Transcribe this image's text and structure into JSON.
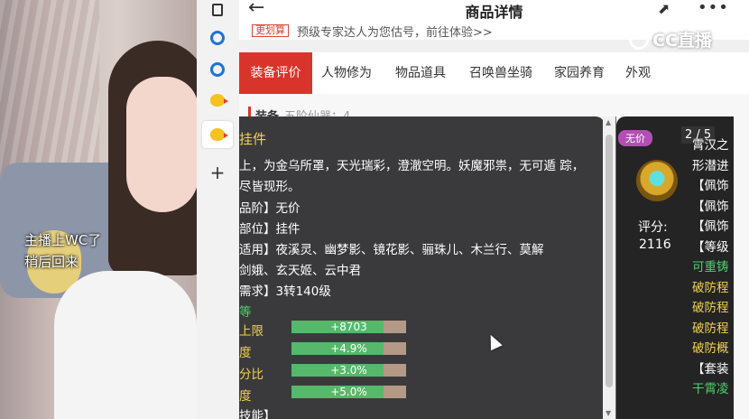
{
  "cam": {
    "note_line1": "主播上WC了",
    "note_line2": "稍后回来"
  },
  "tabstrip": {
    "items": [
      {
        "icon": "tabs-icon"
      },
      {
        "icon": "ie-icon"
      },
      {
        "icon": "ie-icon"
      },
      {
        "icon": "chick-icon"
      },
      {
        "icon": "chick-icon",
        "active": true
      },
      {
        "icon": "plus-icon"
      }
    ]
  },
  "header": {
    "title": "商品详情",
    "back": "←",
    "share": "⬈",
    "more": "•••"
  },
  "notice": {
    "badge": "更划算",
    "text": "预级专家达人为您估号，前往体验>>"
  },
  "tabs": [
    "装备评价",
    "人物修为",
    "物品道具",
    "召唤兽坐骑",
    "家园养育",
    "外观"
  ],
  "section": {
    "title": "装备",
    "subtitle": "五阶仙器：4"
  },
  "tooltip": {
    "name": "挂件",
    "desc": "上，为金乌所罩，天光瑞彩，澄澈空明。妖魔邪祟，无可遁 踪，尽皆现形。",
    "lines": [
      "品阶】无价",
      "部位】挂件",
      "适用】夜溪灵、幽梦影、镜花影、骊珠儿、木兰行、莫解",
      "剑娥、玄天姬、云中君",
      "需求】3转140级"
    ],
    "green": "等",
    "attrs": [
      {
        "label": "上限",
        "value": "+8703",
        "pct": 0.8
      },
      {
        "label": "度",
        "value": "+4.9%",
        "pct": 0.8
      },
      {
        "label": "分比",
        "value": "+3.0%",
        "pct": 0.8
      },
      {
        "label": "度",
        "value": "+5.0%",
        "pct": 0.8
      }
    ],
    "last": "技能】"
  },
  "card": {
    "badge": "无价",
    "pager": "2 / 5",
    "score_label": "评分:",
    "score": "2116",
    "lines": [
      {
        "text": "霄汉之",
        "color": "#ffffff"
      },
      {
        "text": "形潜进",
        "color": "#ffffff"
      },
      {
        "text": "【佩饰",
        "color": "#ffffff"
      },
      {
        "text": "【佩饰",
        "color": "#ffffff"
      },
      {
        "text": "【佩饰",
        "color": "#ffffff"
      },
      {
        "text": "【等级",
        "color": "#ffffff"
      },
      {
        "text": "可重铸",
        "color": "#4cd26b"
      },
      {
        "text": "破防程",
        "color": "#f2d24d"
      },
      {
        "text": "破防程",
        "color": "#f2d24d"
      },
      {
        "text": "破防程",
        "color": "#f2d24d"
      },
      {
        "text": "破防概",
        "color": "#f2d24d"
      },
      {
        "text": "【套装",
        "color": "#ffffff"
      },
      {
        "text": "干霄凌",
        "color": "#4cd26b"
      }
    ]
  },
  "watermark": "CC直播"
}
